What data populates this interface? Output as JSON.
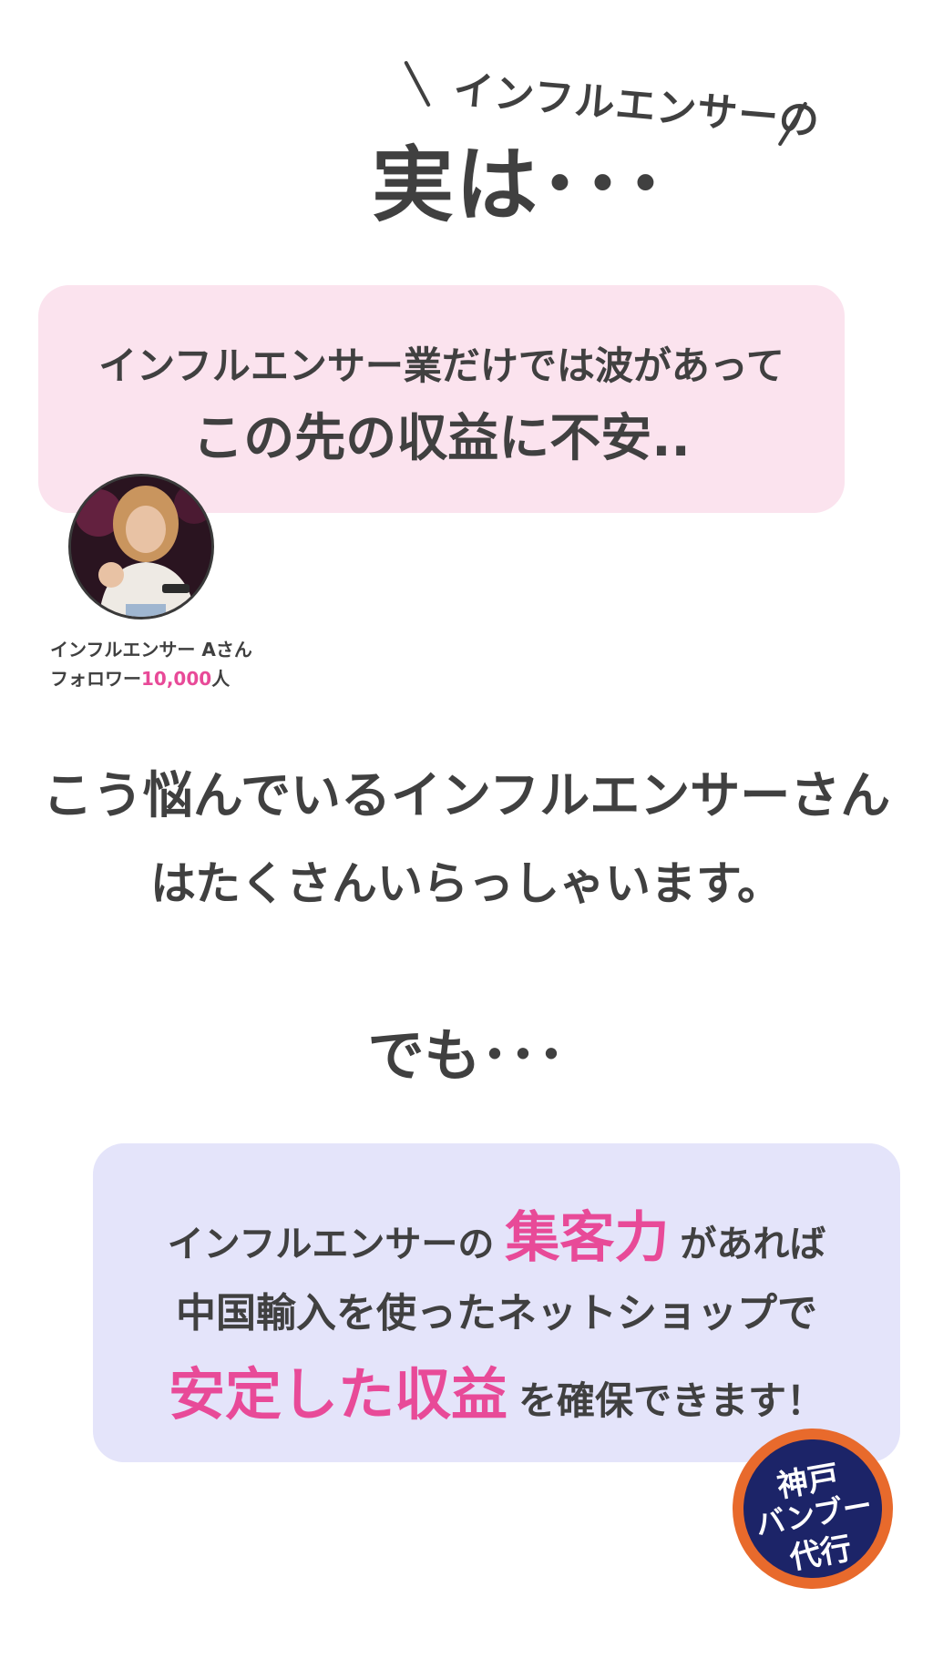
{
  "header": {
    "kicker": "インフルエンサーの",
    "title": "実は･･･"
  },
  "worry_bubble": {
    "line1": "インフルエンサー業だけでは波があって",
    "line2": "この先の収益に不安.."
  },
  "profile": {
    "name": "インフルエンサー Aさん",
    "followers_label": "フォロワー",
    "followers_count": "10,000",
    "followers_unit": "人"
  },
  "message": {
    "line1": "こう悩んでいるインフルエンサーさん",
    "line2": "はたくさんいらっしゃいます。",
    "but": "でも･･･"
  },
  "solution_bubble": {
    "line1_prefix": "インフルエンサーの",
    "line1_accent": "集客力",
    "line1_suffix": "があれば",
    "line2": "中国輸入を使ったネットショップで",
    "line3_accent": "安定した収益",
    "line3_suffix": "を確保できます！"
  },
  "badge": {
    "line1": "神戸",
    "line2": "バンブー",
    "line3": "代行"
  },
  "colors": {
    "text": "#404040",
    "accent_pink": "#e84a98",
    "pink_bubble": "#fbe3ee",
    "lavender_bubble": "#e4e4fa",
    "badge_navy": "#1c2468",
    "badge_orange": "#e86a2c"
  }
}
